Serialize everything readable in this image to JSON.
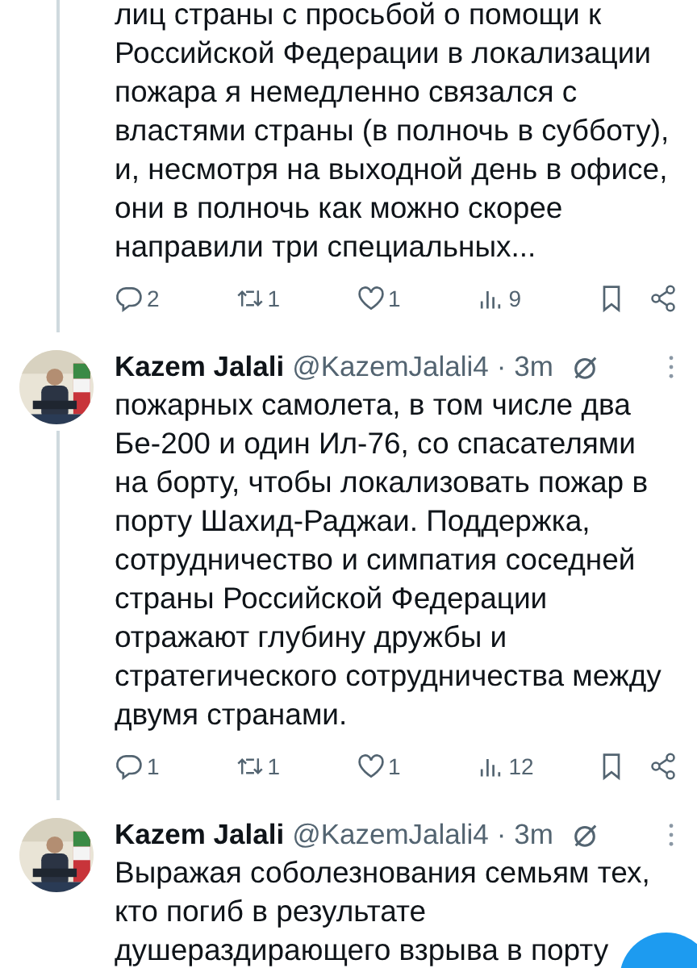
{
  "tweets": [
    {
      "show_header": false,
      "thread_line": true,
      "text": "лиц страны с просьбой о помощи к\nРоссийской Федерации в локализации\nпожара я немедленно связался с\nвластями страны (в полночь в субботу),\nи, несмотря на выходной день в офисе,\nони в полночь как можно скорее\nнаправили три специальных...",
      "stats": {
        "replies": "2",
        "reposts": "1",
        "likes": "1",
        "views": "9"
      }
    },
    {
      "show_header": true,
      "thread_line": true,
      "name": "Kazem Jalali",
      "handle": "@KazemJalali4",
      "time": "· 3m",
      "text": "пожарных самолета, в том числе два\nБе-200 и один Ил-76, со спасателями\nна борту, чтобы локализовать пожар в\nпорту Шахид-Раджаи. Поддержка,\nсотрудничество и симпатия соседней\nстраны Российской Федерации\nотражают глубину дружбы и\nстратегического сотрудничества между\nдвумя странами.",
      "stats": {
        "replies": "1",
        "reposts": "1",
        "likes": "1",
        "views": "12"
      }
    },
    {
      "show_header": true,
      "thread_line": false,
      "name": "Kazem Jalali",
      "handle": "@KazemJalali4",
      "time": "· 3m",
      "text": "Выражая соболезнования семьям тех,\nкто погиб в результате\nдушераздирающего взрыва в порту"
    }
  ]
}
